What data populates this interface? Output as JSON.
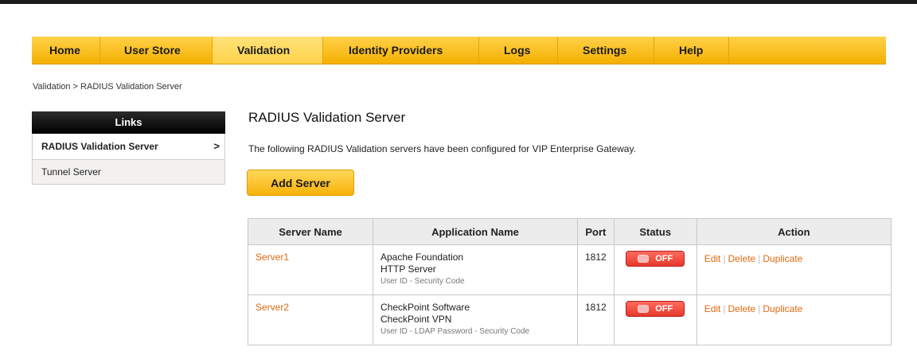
{
  "nav": {
    "items": [
      {
        "label": "Home"
      },
      {
        "label": "User Store"
      },
      {
        "label": "Validation"
      },
      {
        "label": "Identity Providers"
      },
      {
        "label": "Logs"
      },
      {
        "label": "Settings"
      },
      {
        "label": "Help"
      }
    ],
    "active": "Validation"
  },
  "breadcrumb": "Validation > RADIUS Validation Server",
  "sidebar": {
    "header": "Links",
    "items": [
      {
        "label": "RADIUS Validation Server"
      },
      {
        "label": "Tunnel Server"
      }
    ],
    "chevron": ">"
  },
  "main": {
    "title": "RADIUS Validation Server",
    "description": "The following RADIUS Validation servers have been configured for VIP Enterprise Gateway.",
    "add_button": "Add Server"
  },
  "table": {
    "headers": [
      "Server Name",
      "Application Name",
      "Port",
      "Status",
      "Action"
    ],
    "rows": [
      {
        "server": "Server1",
        "app_line1": "Apache Foundation",
        "app_line2": "HTTP Server",
        "app_sub": "User ID - Security Code",
        "port": "1812",
        "status": "OFF"
      },
      {
        "server": "Server2",
        "app_line1": "CheckPoint Software",
        "app_line2": "CheckPoint VPN",
        "app_sub": "User ID - LDAP Password - Security Code",
        "port": "1812",
        "status": "OFF"
      }
    ],
    "actions": {
      "edit": "Edit",
      "delete": "Delete",
      "duplicate": "Duplicate",
      "separator": "|"
    }
  },
  "colors": {
    "nav_bg": "#f5b000",
    "link": "#e06a10",
    "toggle_off": "#e53a2c",
    "sidebar_header": "#000000"
  }
}
